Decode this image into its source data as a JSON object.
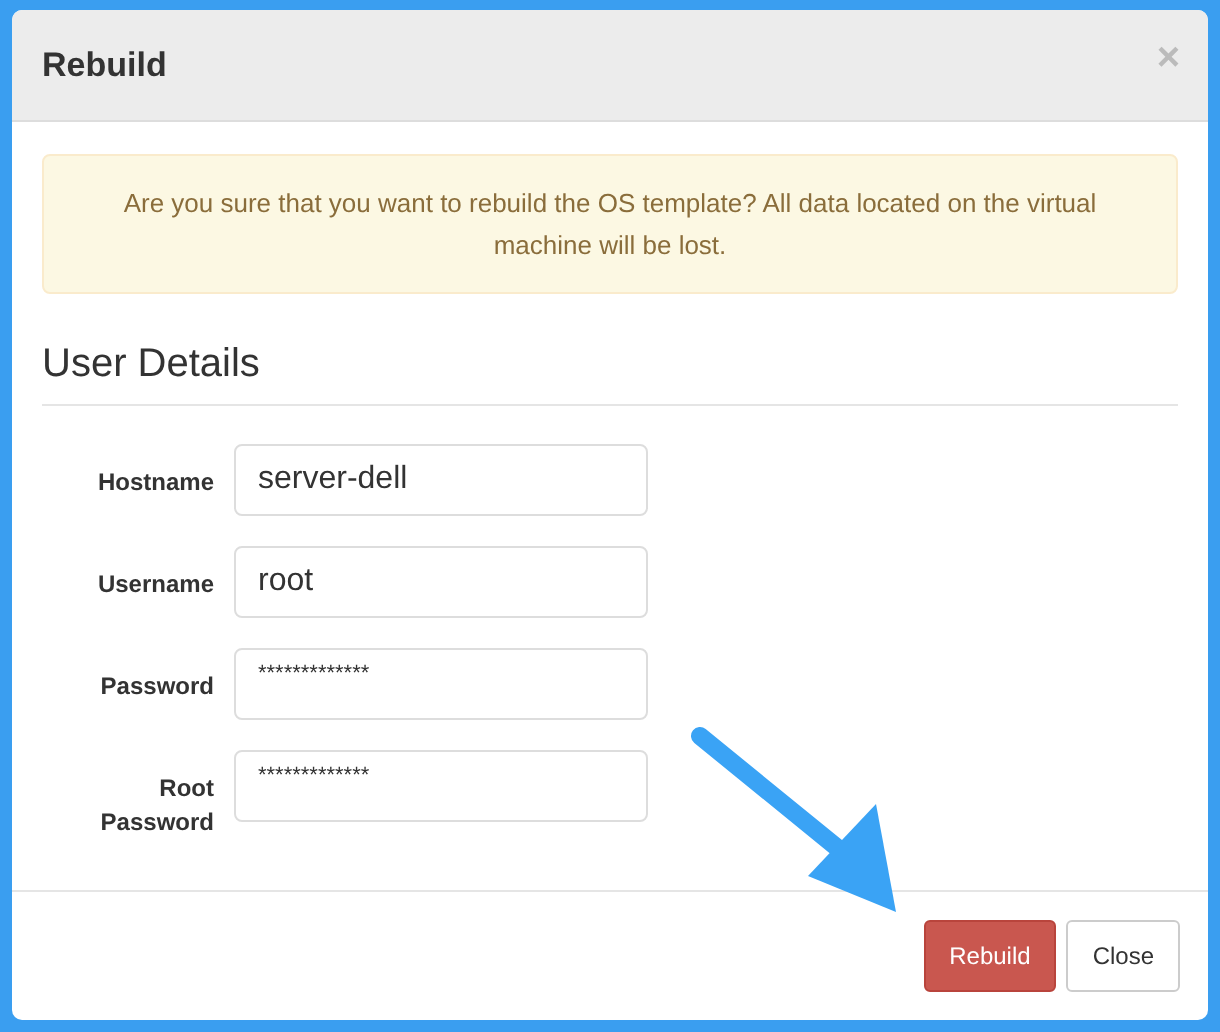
{
  "dialog": {
    "title": "Rebuild",
    "close": "×"
  },
  "alert": {
    "text": "Are you sure that you want to rebuild the OS template? All data located on the virtual machine will be lost."
  },
  "section": {
    "title": "User Details"
  },
  "fields": [
    {
      "label": "Hostname",
      "value": "server-dell",
      "kind": "text"
    },
    {
      "label": "Username",
      "value": "root",
      "kind": "text"
    },
    {
      "label": "Password",
      "value": "*************",
      "kind": "masked"
    },
    {
      "label": "Root Password",
      "value": "*************",
      "kind": "masked"
    }
  ],
  "buttons": [
    {
      "label": "Rebuild",
      "kind": "danger"
    },
    {
      "label": "Close",
      "kind": "default"
    }
  ]
}
